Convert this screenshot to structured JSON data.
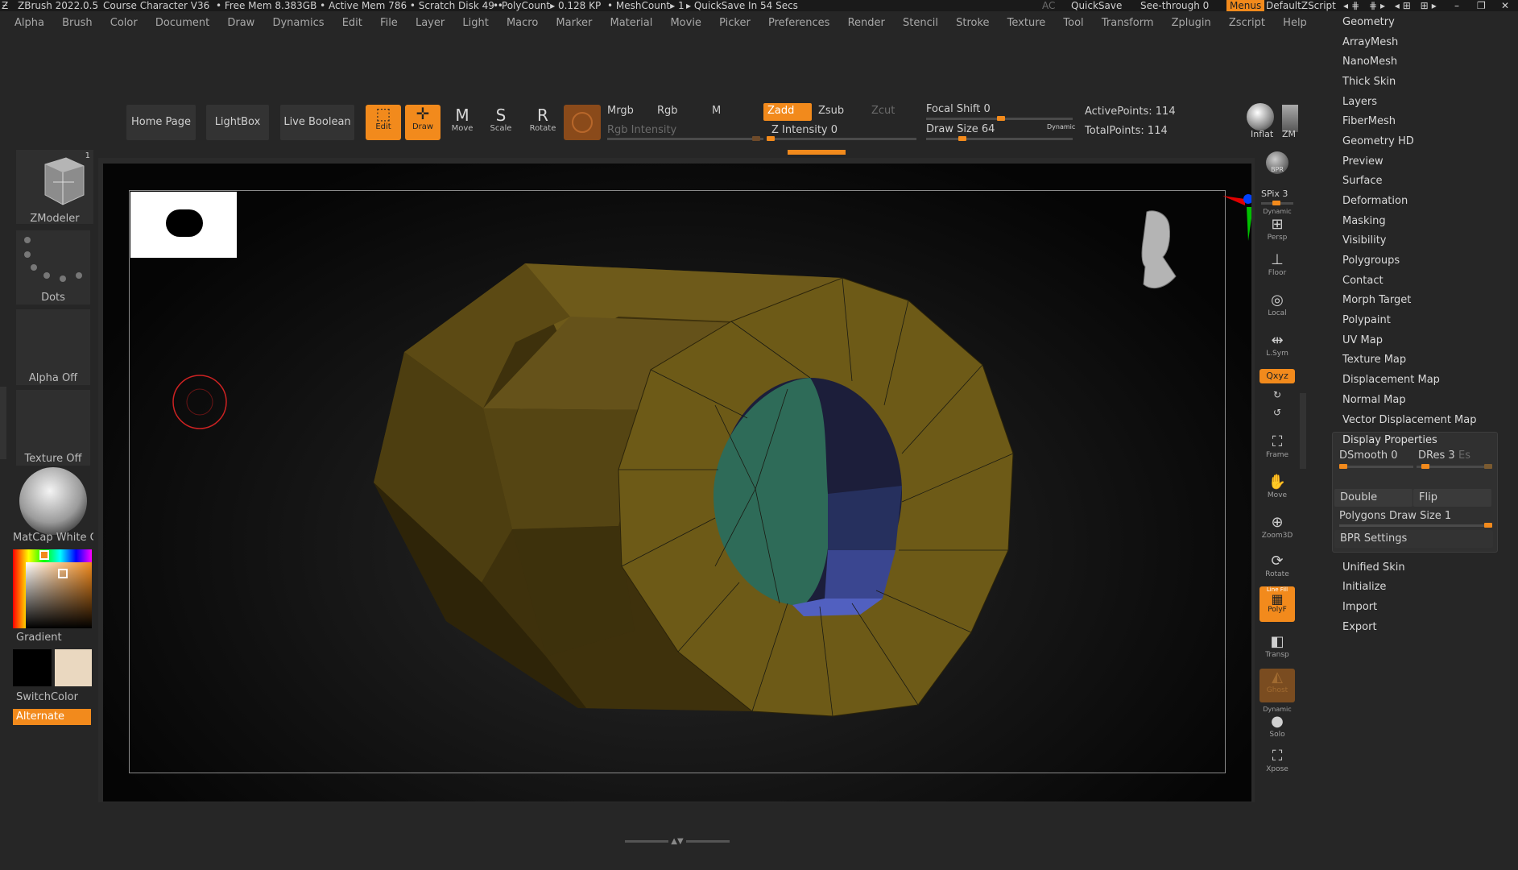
{
  "titlebar": {
    "app": "ZBrush 2022.0.5",
    "doc": "Course Character V36",
    "stats": "• Free Mem 8.383GB • Active Mem 786 • Scratch Disk 49 •",
    "poly": "• PolyCount▸ 0.128 KP",
    "mesh": "• MeshCount▸ 1",
    "quicksave_in": "▸ QuickSave In 54 Secs",
    "ac": "AC",
    "quicksave": "QuickSave",
    "seethrough": "See-through   0",
    "menus": "Menus",
    "script": "DefaultZScript"
  },
  "menubar": [
    "Alpha",
    "Brush",
    "Color",
    "Document",
    "Draw",
    "Dynamics",
    "Edit",
    "File",
    "Layer",
    "Light",
    "Macro",
    "Marker",
    "Material",
    "Movie",
    "Picker",
    "Preferences",
    "Render",
    "Stencil",
    "Stroke",
    "Texture",
    "Tool",
    "Transform",
    "Zplugin",
    "Zscript",
    "Help"
  ],
  "toolbar": {
    "home": "Home Page",
    "lightbox": "LightBox",
    "liveboolean": "Live Boolean",
    "edit": "Edit",
    "draw": "Draw",
    "move": "Move",
    "scale": "Scale",
    "rotate": "Rotate",
    "mrgb": "Mrgb",
    "rgb": "Rgb",
    "m": "M",
    "rgb_intensity": "Rgb Intensity",
    "zadd": "Zadd",
    "zsub": "Zsub",
    "zcut": "Zcut",
    "z_intensity": "Z Intensity 0",
    "focal_shift": "Focal Shift 0",
    "draw_size": "Draw Size 64",
    "dynamic": "Dynamic",
    "active_points": "ActivePoints: 114",
    "total_points": "TotalPoints: 114",
    "inflat": "Inflat",
    "zm": "ZM"
  },
  "left": {
    "brush": "ZModeler",
    "brush_badge": "1",
    "stroke": "Dots",
    "alpha": "Alpha Off",
    "texture": "Texture Off",
    "material": "MatCap White C",
    "gradient": "Gradient",
    "switchcolor": "SwitchColor",
    "alternate": "Alternate",
    "main_color": "#000000",
    "secondary_color": "#ead8c0"
  },
  "right": {
    "bpr": "BPR",
    "spix": "SPix 3",
    "dynamic": "Dynamic",
    "persp": "Persp",
    "floor": "Floor",
    "local": "Local",
    "lsym": "L.Sym",
    "xyz": "Qxyz",
    "frame": "Frame",
    "move": "Move",
    "zoom": "Zoom3D",
    "rotate": "Rotate",
    "linefill": "Line Fill",
    "polyf": "PolyF",
    "transp": "Transp",
    "ghost": "Ghost",
    "solo_dyn": "Dynamic",
    "solo": "Solo",
    "xpose": "Xpose"
  },
  "toolmenu": {
    "items": [
      "Geometry",
      "ArrayMesh",
      "NanoMesh",
      "Thick Skin",
      "Layers",
      "FiberMesh",
      "Geometry HD",
      "Preview",
      "Surface",
      "Deformation",
      "Masking",
      "Visibility",
      "Polygroups",
      "Contact",
      "Morph Target",
      "Polypaint",
      "UV Map",
      "Texture Map",
      "Displacement Map",
      "Normal Map",
      "Vector Displacement Map"
    ],
    "display_properties": "Display Properties",
    "dsmooth": "DSmooth 0",
    "dres": "DRes 3",
    "es": "Es",
    "double": "Double",
    "flip": "Flip",
    "poly_draw_size": "Polygons Draw Size 1",
    "bpr_settings": "BPR Settings",
    "after": [
      "Unified Skin",
      "Initialize",
      "Import",
      "Export"
    ]
  }
}
